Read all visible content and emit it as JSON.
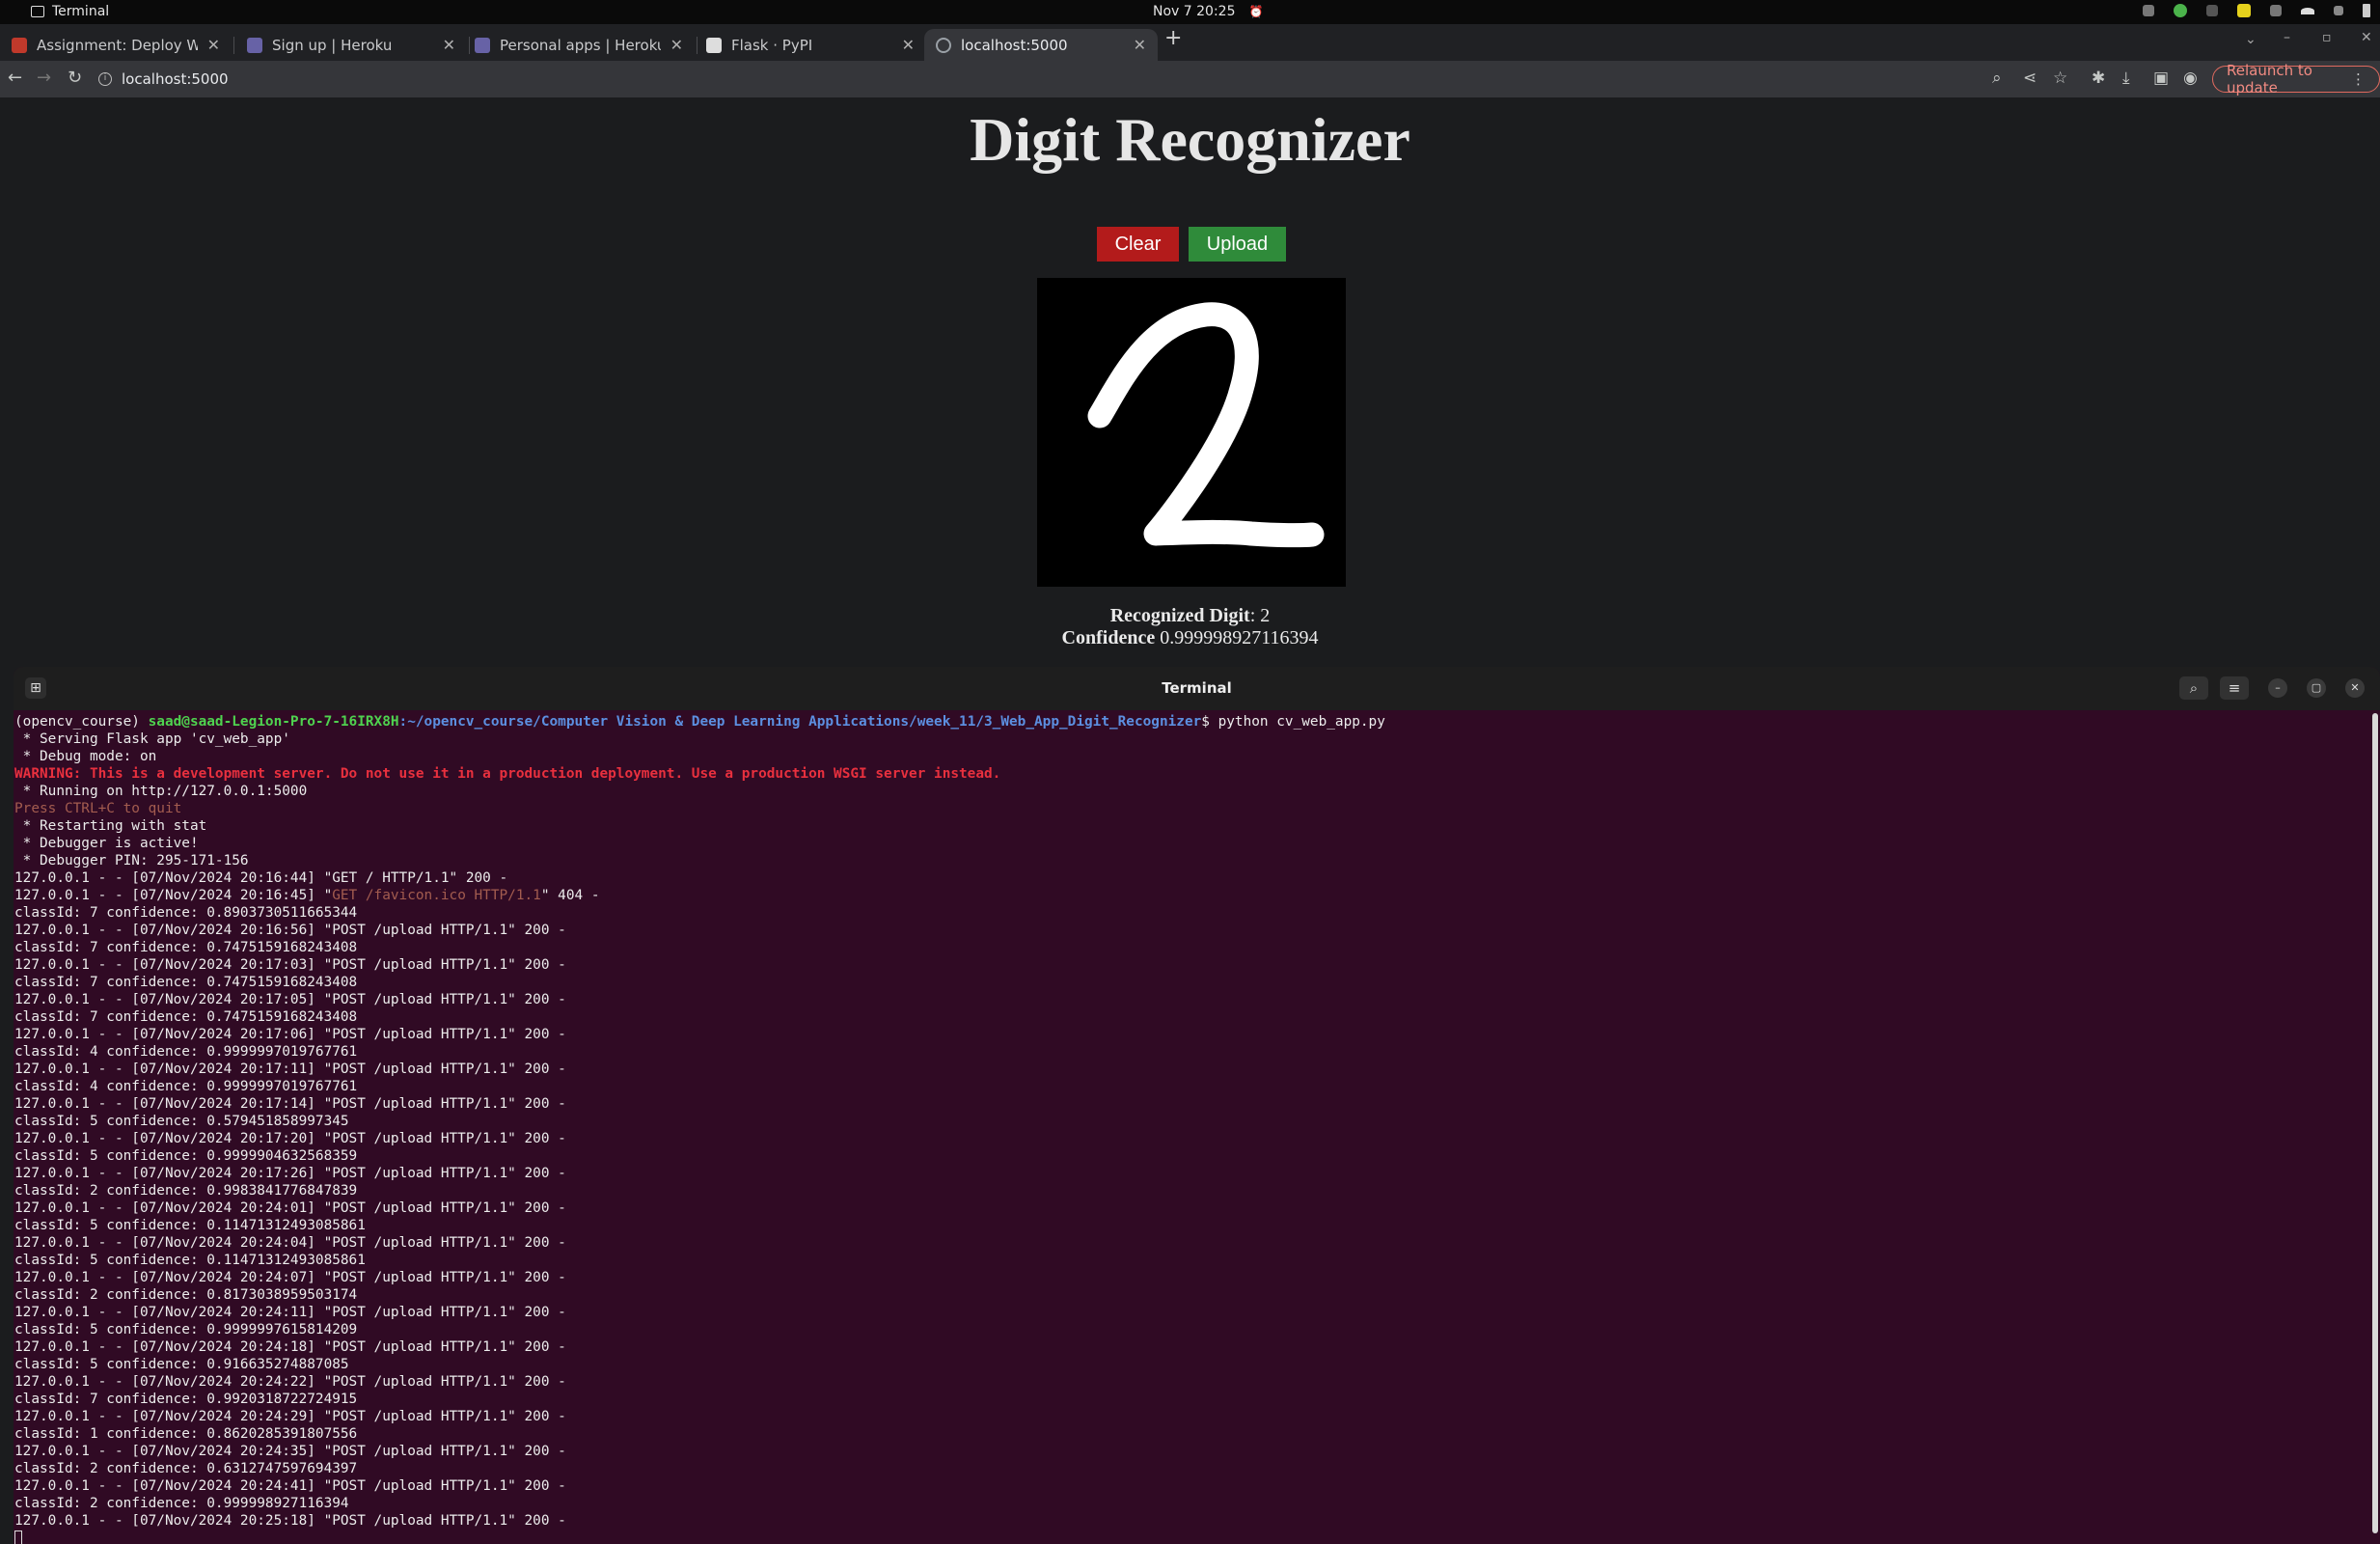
{
  "topbar": {
    "app_name": "Terminal",
    "datetime": "Nov 7  20:25"
  },
  "browser": {
    "tabs": [
      {
        "title": "Assignment: Deploy Web",
        "favicon_color": "#c0392b"
      },
      {
        "title": "Sign up | Heroku",
        "favicon_color": "#6762a6"
      },
      {
        "title": "Personal apps | Heroku",
        "favicon_color": "#6762a6"
      },
      {
        "title": "Flask · PyPI",
        "favicon_color": "#dddddd"
      },
      {
        "title": "localhost:5000",
        "favicon_color": "#9aa0a6"
      }
    ],
    "active_tab": 4,
    "url": "localhost:5000",
    "relaunch_label": "Relaunch to update"
  },
  "page": {
    "title": "Digit Recognizer",
    "clear_label": "Clear",
    "upload_label": "Upload",
    "recognized_label": "Recognized Digit",
    "recognized_value": ": 2",
    "confidence_label": "Confidence",
    "confidence_value": " 0.999998927116394"
  },
  "terminal": {
    "title": "Terminal",
    "prompt_env": "(opencv_course) ",
    "prompt_user": "saad@saad-Legion-Pro-7-16IRX8H",
    "prompt_path": ":~/opencv_course/Computer Vision & Deep Learning Applications/week_11/3_Web_App_Digit_Recognizer",
    "prompt_cmd": "$ python cv_web_app.py",
    "lines": [
      {
        "text": " * Serving Flask app 'cv_web_app'",
        "style": ""
      },
      {
        "text": " * Debug mode: on",
        "style": ""
      },
      {
        "text": "WARNING: This is a development server. Do not use it in a production deployment. Use a production WSGI server instead.",
        "style": "c-red"
      },
      {
        "text": " * Running on http://127.0.0.1:5000",
        "style": ""
      },
      {
        "text": "Press CTRL+C to quit",
        "style": "c-dim"
      },
      {
        "text": " * Restarting with stat",
        "style": ""
      },
      {
        "text": " * Debugger is active!",
        "style": ""
      },
      {
        "text": " * Debugger PIN: 295-171-156",
        "style": ""
      },
      {
        "text": "127.0.0.1 - - [07/Nov/2024 20:16:44] \"GET / HTTP/1.1\" 200 -",
        "style": ""
      },
      {
        "text": "127.0.0.1 - - [07/Nov/2024 20:16:45] \"GET /favicon.ico HTTP/1.1\" 404 -",
        "style": "favicon"
      },
      {
        "text": "classId: 7 confidence: 0.8903730511665344",
        "style": ""
      },
      {
        "text": "127.0.0.1 - - [07/Nov/2024 20:16:56] \"POST /upload HTTP/1.1\" 200 -",
        "style": ""
      },
      {
        "text": "classId: 7 confidence: 0.7475159168243408",
        "style": ""
      },
      {
        "text": "127.0.0.1 - - [07/Nov/2024 20:17:03] \"POST /upload HTTP/1.1\" 200 -",
        "style": ""
      },
      {
        "text": "classId: 7 confidence: 0.7475159168243408",
        "style": ""
      },
      {
        "text": "127.0.0.1 - - [07/Nov/2024 20:17:05] \"POST /upload HTTP/1.1\" 200 -",
        "style": ""
      },
      {
        "text": "classId: 7 confidence: 0.7475159168243408",
        "style": ""
      },
      {
        "text": "127.0.0.1 - - [07/Nov/2024 20:17:06] \"POST /upload HTTP/1.1\" 200 -",
        "style": ""
      },
      {
        "text": "classId: 4 confidence: 0.9999997019767761",
        "style": ""
      },
      {
        "text": "127.0.0.1 - - [07/Nov/2024 20:17:11] \"POST /upload HTTP/1.1\" 200 -",
        "style": ""
      },
      {
        "text": "classId: 4 confidence: 0.9999997019767761",
        "style": ""
      },
      {
        "text": "127.0.0.1 - - [07/Nov/2024 20:17:14] \"POST /upload HTTP/1.1\" 200 -",
        "style": ""
      },
      {
        "text": "classId: 5 confidence: 0.579451858997345",
        "style": ""
      },
      {
        "text": "127.0.0.1 - - [07/Nov/2024 20:17:20] \"POST /upload HTTP/1.1\" 200 -",
        "style": ""
      },
      {
        "text": "classId: 5 confidence: 0.9999904632568359",
        "style": ""
      },
      {
        "text": "127.0.0.1 - - [07/Nov/2024 20:17:26] \"POST /upload HTTP/1.1\" 200 -",
        "style": ""
      },
      {
        "text": "classId: 2 confidence: 0.9983841776847839",
        "style": ""
      },
      {
        "text": "127.0.0.1 - - [07/Nov/2024 20:24:01] \"POST /upload HTTP/1.1\" 200 -",
        "style": ""
      },
      {
        "text": "classId: 5 confidence: 0.11471312493085861",
        "style": ""
      },
      {
        "text": "127.0.0.1 - - [07/Nov/2024 20:24:04] \"POST /upload HTTP/1.1\" 200 -",
        "style": ""
      },
      {
        "text": "classId: 5 confidence: 0.11471312493085861",
        "style": ""
      },
      {
        "text": "127.0.0.1 - - [07/Nov/2024 20:24:07] \"POST /upload HTTP/1.1\" 200 -",
        "style": ""
      },
      {
        "text": "classId: 2 confidence: 0.8173038959503174",
        "style": ""
      },
      {
        "text": "127.0.0.1 - - [07/Nov/2024 20:24:11] \"POST /upload HTTP/1.1\" 200 -",
        "style": ""
      },
      {
        "text": "classId: 5 confidence: 0.9999997615814209",
        "style": ""
      },
      {
        "text": "127.0.0.1 - - [07/Nov/2024 20:24:18] \"POST /upload HTTP/1.1\" 200 -",
        "style": ""
      },
      {
        "text": "classId: 5 confidence: 0.916635274887085",
        "style": ""
      },
      {
        "text": "127.0.0.1 - - [07/Nov/2024 20:24:22] \"POST /upload HTTP/1.1\" 200 -",
        "style": ""
      },
      {
        "text": "classId: 7 confidence: 0.9920318722724915",
        "style": ""
      },
      {
        "text": "127.0.0.1 - - [07/Nov/2024 20:24:29] \"POST /upload HTTP/1.1\" 200 -",
        "style": ""
      },
      {
        "text": "classId: 1 confidence: 0.8620285391807556",
        "style": ""
      },
      {
        "text": "127.0.0.1 - - [07/Nov/2024 20:24:35] \"POST /upload HTTP/1.1\" 200 -",
        "style": ""
      },
      {
        "text": "classId: 2 confidence: 0.6312747597694397",
        "style": ""
      },
      {
        "text": "127.0.0.1 - - [07/Nov/2024 20:24:41] \"POST /upload HTTP/1.1\" 200 -",
        "style": ""
      },
      {
        "text": "classId: 2 confidence: 0.999998927116394",
        "style": ""
      },
      {
        "text": "127.0.0.1 - - [07/Nov/2024 20:25:18] \"POST /upload HTTP/1.1\" 200 -",
        "style": ""
      }
    ]
  },
  "colors": {
    "clear_button": "#b31b1b",
    "upload_button": "#2f8b3a",
    "terminal_bg": "#300a24",
    "warning": "#e8303e"
  }
}
